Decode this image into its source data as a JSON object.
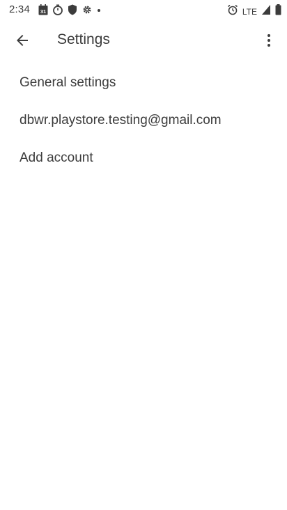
{
  "status_bar": {
    "time": "2:34",
    "network": "LTE",
    "left_icons": [
      "calendar-icon",
      "timer-icon",
      "shield-icon",
      "settings-gear-icon",
      "dot-icon"
    ],
    "right_icons": [
      "alarm-icon",
      "signal-icon",
      "battery-icon"
    ],
    "calendar_day": "31"
  },
  "app_bar": {
    "title": "Settings",
    "back_icon": "arrow-back-icon",
    "overflow_icon": "more-vert-icon"
  },
  "settings": {
    "items": [
      {
        "label": "General settings"
      },
      {
        "label": "dbwr.playstore.testing@gmail.com"
      },
      {
        "label": "Add account"
      }
    ]
  },
  "colors": {
    "text": "#3c3c3c",
    "background": "#ffffff"
  }
}
